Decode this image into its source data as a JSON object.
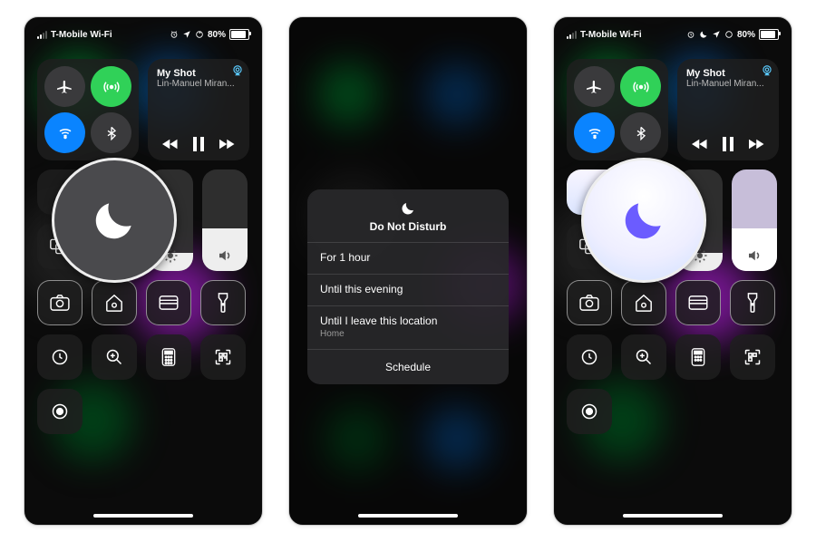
{
  "status": {
    "carrier": "T-Mobile Wi-Fi",
    "battery_pct": "80%",
    "icons": [
      "alarm",
      "location",
      "lock"
    ]
  },
  "music": {
    "title": "My Shot",
    "artist": "Lin-Manuel Miran..."
  },
  "connectivity": {
    "airplane": false,
    "cellular": true,
    "wifi": true,
    "bluetooth": false
  },
  "focus": {
    "label_off": "Do Not Disturb",
    "label_on": "Do Not Disturb"
  },
  "sliders": {
    "brightness_pct": 18,
    "volume_pct": 42
  },
  "utility_row1": [
    "camera",
    "home",
    "wallet",
    "flashlight"
  ],
  "utility_row2": [
    "timer",
    "magnifier",
    "calculator",
    "qr-scan"
  ],
  "utility_row3": [
    "screen-record"
  ],
  "dnd_menu": {
    "title": "Do Not Disturb",
    "options": [
      {
        "label": "For 1 hour"
      },
      {
        "label": "Until this evening"
      },
      {
        "label": "Until I leave this location",
        "sub": "Home"
      }
    ],
    "schedule": "Schedule"
  },
  "callout": {
    "off_color": "#4a4a4d",
    "on_color": "#6b5cff"
  }
}
